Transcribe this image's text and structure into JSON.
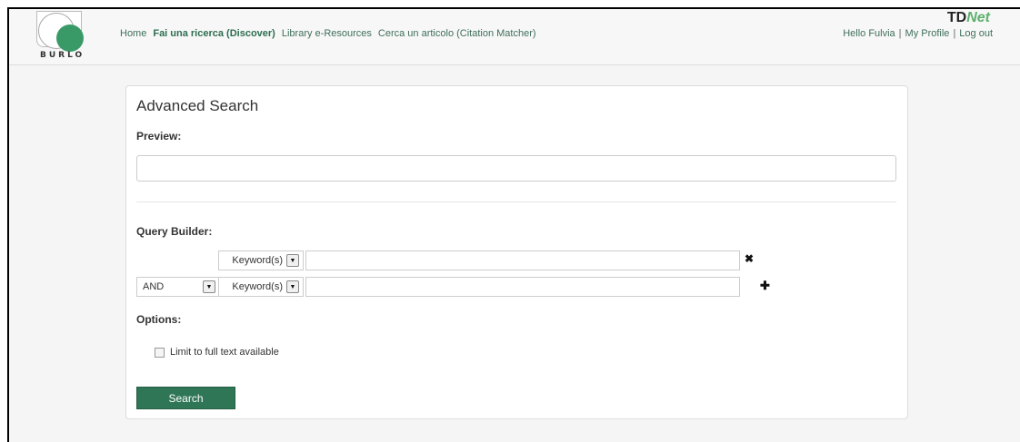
{
  "header": {
    "logo_text": "BURLO",
    "nav": [
      {
        "label": "Home",
        "active": false
      },
      {
        "label": "Fai una ricerca (Discover)",
        "active": true
      },
      {
        "label": "Library e-Resources",
        "active": false
      },
      {
        "label": "Cerca un articolo (Citation Matcher)",
        "active": false
      }
    ],
    "brand": {
      "td": "TD",
      "net": "Net"
    },
    "user": {
      "greeting": "Hello Fulvia",
      "profile": "My Profile",
      "logout": "Log out",
      "separator": "|"
    }
  },
  "panel": {
    "title": "Advanced Search",
    "preview_label": "Preview:",
    "preview_value": "",
    "query_builder_label": "Query Builder:",
    "rows": [
      {
        "operator": "",
        "field": "Keyword(s)",
        "value": "",
        "action_icon": "remove-icon",
        "action_glyph": "✖"
      },
      {
        "operator": "AND",
        "field": "Keyword(s)",
        "value": "",
        "action_icon": "add-icon",
        "action_glyph": "✚"
      }
    ],
    "options_label": "Options:",
    "fulltext_label": "Limit to full text available",
    "fulltext_checked": false,
    "search_button": "Search"
  },
  "colors": {
    "accent": "#2f7656",
    "link": "#3f6f5a",
    "brand_green": "#5db06e"
  }
}
